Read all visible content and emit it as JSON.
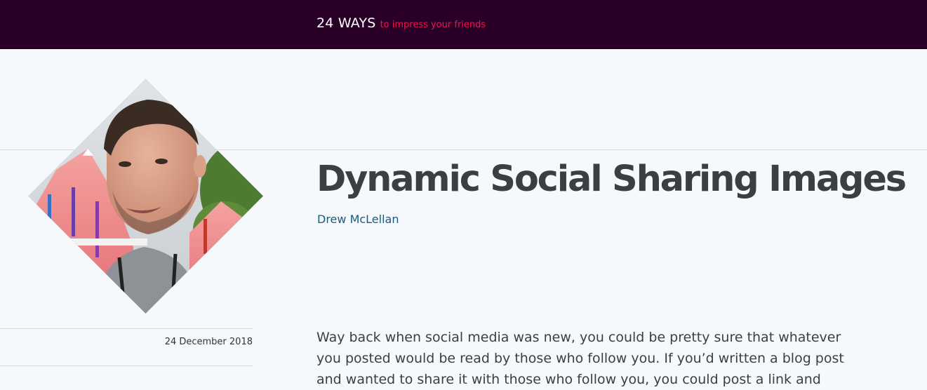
{
  "header": {
    "brand_name": "24 WAYS",
    "tagline": "to impress your friends"
  },
  "article": {
    "title": "Dynamic Social Sharing Images",
    "author": "Drew McLellan",
    "date": "24 December 2018",
    "intro": "Way back when social media was new, you could be pretty sure that whatever you posted would be read by those who follow you. If you’d written a blog post and wanted to share it with those who follow you, you could post a link and"
  },
  "colors": {
    "header_bg": "#2a0028",
    "tagline": "#f0134d",
    "author_link": "#1b5a7a",
    "title": "#3d3e44",
    "page_bg": "#f5f9fc"
  }
}
